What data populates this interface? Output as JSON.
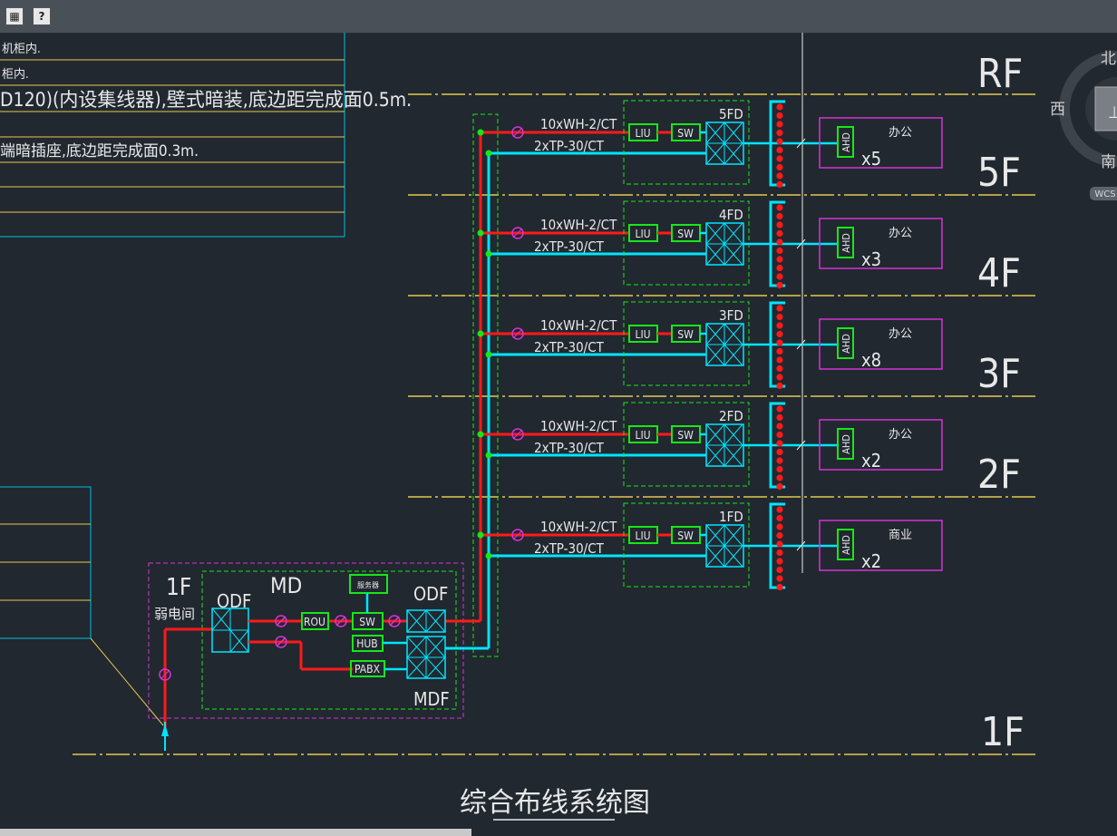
{
  "toolbar": {
    "calc_icon": "calculator-icon",
    "help_label": "?"
  },
  "notes_top": [
    "机柜内.",
    "柜内.",
    "D120)(内设集线器),壁式暗装,底边距完成面0.5m.",
    "",
    "端暗插座,底边距完成面0.3m."
  ],
  "floors": [
    {
      "level": "RF",
      "fd": "",
      "unit_label": "",
      "count": ""
    },
    {
      "level": "5F",
      "fd": "5FD",
      "unit_label": "办公",
      "count": "x5"
    },
    {
      "level": "4F",
      "fd": "4FD",
      "unit_label": "办公",
      "count": "x3"
    },
    {
      "level": "3F",
      "fd": "3FD",
      "unit_label": "办公",
      "count": "x8"
    },
    {
      "level": "2F",
      "fd": "2FD",
      "unit_label": "办公",
      "count": "x2"
    },
    {
      "level": "1F",
      "fd": "1FD",
      "unit_label": "商业",
      "count": "x2"
    }
  ],
  "cable_labels": {
    "fiber": "10xWH-2/CT",
    "copper": "2xTP-30/CT"
  },
  "devices": {
    "liu": "LIU",
    "sw": "SW",
    "ahd": "AHD",
    "rou": "ROU",
    "hub": "HUB",
    "pabx": "PABX",
    "server": "服务器",
    "odf": "ODF",
    "md": "MD",
    "mdf": "MDF"
  },
  "room": {
    "floor": "1F",
    "name": "弱电间"
  },
  "bottom_floor": "1F",
  "title": "综合布线系统图",
  "compass": {
    "north": "北",
    "west": "西",
    "south": "南",
    "wcs": "WCS"
  },
  "colors": {
    "red": "#ff1a1a",
    "cyan": "#00e5ff",
    "green": "#19e619",
    "magenta": "#d633d6",
    "yellow": "#e6c84d",
    "white": "#e8e8e8"
  }
}
